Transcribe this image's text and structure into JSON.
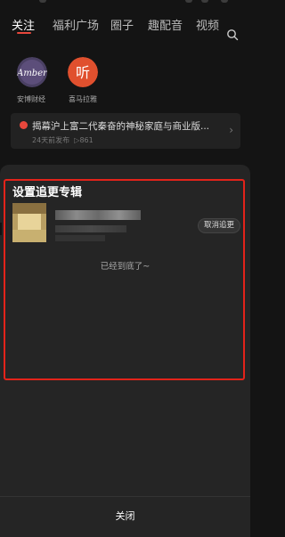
{
  "tabs": [
    {
      "label": "关注",
      "active": true
    },
    {
      "label": "福利广场",
      "active": false
    },
    {
      "label": "圈子",
      "active": false
    },
    {
      "label": "趣配音",
      "active": false
    },
    {
      "label": "视频",
      "active": false
    }
  ],
  "tab_right_icon": "search-icon",
  "subscriptions": [
    {
      "name": "安博财经",
      "avatar_text": "Amber"
    },
    {
      "name": "喜马拉雅",
      "avatar_text": "听"
    }
  ],
  "news": {
    "title": "揭幕沪上富二代秦奋的神秘家庭与商业版...",
    "time": "24天前发布",
    "plays": "861"
  },
  "sheet": {
    "title": "设置追更专辑",
    "unfollow_label": "取消追更",
    "bottom_message": "已经到底了~",
    "close_label": "关闭"
  },
  "colors": {
    "accent": "#e8473c",
    "highlight_box": "#e3231a"
  }
}
